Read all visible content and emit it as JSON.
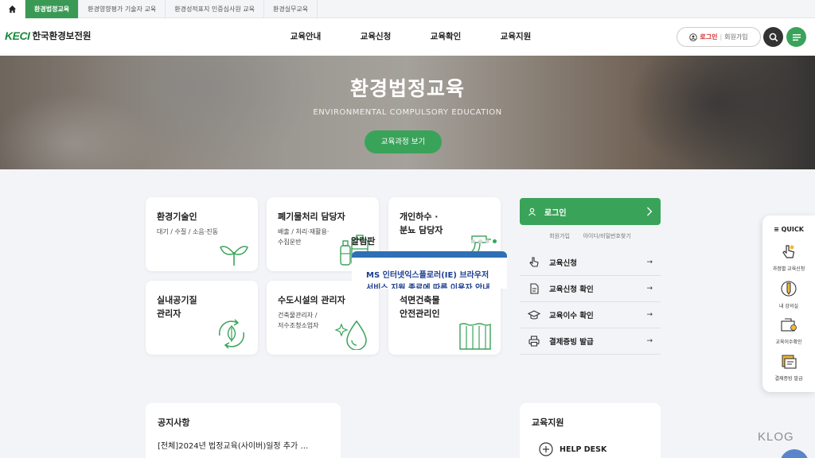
{
  "topbar": {
    "tabs": [
      {
        "label": "환경법정교육",
        "active": true
      },
      {
        "label": "환경영향평가 기술자 교육",
        "active": false
      },
      {
        "label": "환경성적표지 인증심사원 교육",
        "active": false
      },
      {
        "label": "환경실무교육",
        "active": false
      }
    ]
  },
  "header": {
    "logo_mark": "KECI",
    "logo_name": "한국환경보전원",
    "nav": [
      "교육안내",
      "교육신청",
      "교육확인",
      "교육지원"
    ],
    "login_label": "로그인",
    "separator": "|",
    "join_label": "회원가입"
  },
  "hero": {
    "title": "환경법정교육",
    "subtitle": "ENVIRONMENTAL COMPULSORY EDUCATION",
    "button_label": "교육과정 보기"
  },
  "cards": [
    {
      "title": "환경기술인",
      "desc": "대기 / 수질 / 소음·진동",
      "icon": "sprout-icon"
    },
    {
      "title": "폐기물처리 담당자",
      "desc": "배출 / 처리·재활용·\n수집운반",
      "icon": "bottles-icon"
    },
    {
      "title": "개인하수 ·\n분뇨 담당자",
      "desc": "",
      "icon": "wastewater-icon"
    },
    {
      "title": "실내공기질\n관리자",
      "desc": "",
      "icon": "recycle-leaf-icon"
    },
    {
      "title": "수도시설의 관리자",
      "desc": "건축물관리자 /\n저수조청소업자",
      "icon": "water-drop-icon"
    },
    {
      "title": "석면건축물\n안전관리인",
      "desc": "",
      "icon": "building-panel-icon"
    }
  ],
  "sidepanel": {
    "login_label": "로그인",
    "join_label": "회원가입",
    "find_label": "아이디/비밀번호찾기",
    "services": [
      {
        "label": "교육신청",
        "icon": "pointer-icon"
      },
      {
        "label": "교육신청 확인",
        "icon": "document-icon"
      },
      {
        "label": "교육이수 확인",
        "icon": "graduation-cap-icon"
      },
      {
        "label": "결제증빙 발급",
        "icon": "printer-icon"
      }
    ],
    "arrow": "→"
  },
  "notice": {
    "title": "공지사항",
    "item": "[전체]2024년 법정교육(사이버)일정 추가 …"
  },
  "alarm": {
    "title": "알림판",
    "banner_line1": "MS 인터넷익스플로러(IE) 브라우저",
    "banner_line2": "서비스 지원 종료에 따른 이용자 안내"
  },
  "support": {
    "title": "교육지원",
    "help_label": "HELP DESK"
  },
  "quick": {
    "title": "QUICK",
    "items": [
      {
        "label": "과정별 교육신청",
        "icon": "hand-pointer-icon"
      },
      {
        "label": "내 강의실",
        "icon": "pencil-icon"
      },
      {
        "label": "교육이수확인",
        "icon": "certificate-icon"
      },
      {
        "label": "결제증빙 발급",
        "icon": "receipt-icon"
      }
    ]
  },
  "watermark": "KLOG",
  "colors": {
    "brand_green": "#3aa35a",
    "login_red": "#d3302f",
    "banner_blue": "#1d3f8f"
  }
}
